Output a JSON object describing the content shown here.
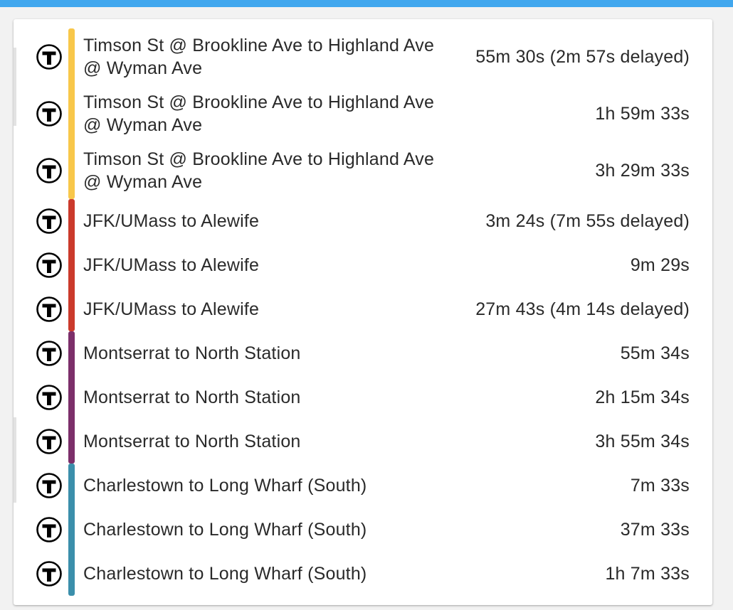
{
  "colors": {
    "top_bar": "#41a7ee",
    "card_bg": "#ffffff",
    "text": "#2a2a2a"
  },
  "departures": [
    {
      "route": "Timson St @ Brookline Ave to Highland Ave @ Wyman Ave",
      "eta": "55m 30s (2m 57s delayed)",
      "line_color": "#f8c74a",
      "icon": "mbta-t-icon"
    },
    {
      "route": "Timson St @ Brookline Ave to Highland Ave @ Wyman Ave",
      "eta": "1h 59m 33s",
      "line_color": "#f8c74a",
      "icon": "mbta-t-icon"
    },
    {
      "route": "Timson St @ Brookline Ave to Highland Ave @ Wyman Ave",
      "eta": "3h 29m 33s",
      "line_color": "#f8c74a",
      "icon": "mbta-t-icon"
    },
    {
      "route": "JFK/UMass to Alewife",
      "eta": "3m 24s (7m 55s delayed)",
      "line_color": "#cb3a2c",
      "icon": "mbta-t-icon"
    },
    {
      "route": "JFK/UMass to Alewife",
      "eta": "9m 29s",
      "line_color": "#cb3a2c",
      "icon": "mbta-t-icon"
    },
    {
      "route": "JFK/UMass to Alewife",
      "eta": "27m 43s (4m 14s delayed)",
      "line_color": "#cb3a2c",
      "icon": "mbta-t-icon"
    },
    {
      "route": "Montserrat to North Station",
      "eta": "55m 34s",
      "line_color": "#7c2f6a",
      "icon": "mbta-t-icon"
    },
    {
      "route": "Montserrat to North Station",
      "eta": "2h 15m 34s",
      "line_color": "#7c2f6a",
      "icon": "mbta-t-icon"
    },
    {
      "route": "Montserrat to North Station",
      "eta": "3h 55m 34s",
      "line_color": "#7c2f6a",
      "icon": "mbta-t-icon"
    },
    {
      "route": "Charlestown to Long Wharf (South)",
      "eta": "7m 33s",
      "line_color": "#3b8fab",
      "icon": "mbta-t-icon"
    },
    {
      "route": "Charlestown to Long Wharf (South)",
      "eta": "37m 33s",
      "line_color": "#3b8fab",
      "icon": "mbta-t-icon"
    },
    {
      "route": "Charlestown to Long Wharf (South)",
      "eta": "1h 7m 33s",
      "line_color": "#3b8fab",
      "icon": "mbta-t-icon"
    }
  ]
}
